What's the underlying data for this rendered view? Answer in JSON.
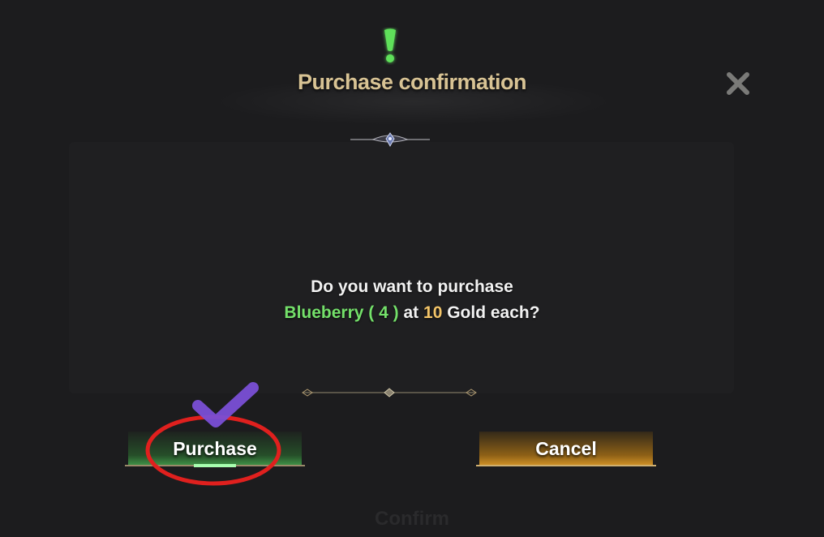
{
  "dialog": {
    "title": "Purchase confirmation",
    "message": {
      "line1": "Do you want to purchase",
      "item_name": "Blueberry",
      "quantity": "( 4 )",
      "at_text": "at",
      "price": "10",
      "currency_text": "Gold each?"
    },
    "buttons": {
      "purchase_label": "Purchase",
      "cancel_label": "Cancel"
    },
    "background_button_label": "Confirm"
  },
  "icons": {
    "alert": "exclamation-icon",
    "close": "close-icon"
  },
  "annotations": {
    "circle_color": "#e0201e",
    "check_color": "#7a4fd6"
  },
  "colors": {
    "title": "#d8c394",
    "item_highlight": "#74e06a",
    "price_highlight": "#f2c468",
    "alert_icon": "#5fe05a"
  }
}
